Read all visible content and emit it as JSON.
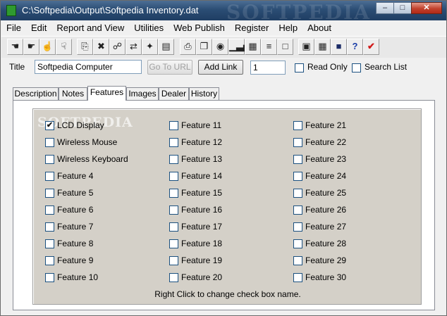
{
  "window": {
    "title": "C:\\Softpedia\\Output\\Softpedia Inventory.dat",
    "watermark": "SOFTPEDIA",
    "minimize_glyph": "–",
    "maximize_glyph": "□",
    "close_glyph": "✕"
  },
  "menu": [
    "File",
    "Edit",
    "Report and View",
    "Utilities",
    "Web Publish",
    "Register",
    "Help",
    "About"
  ],
  "toolbar": {
    "icons": [
      {
        "name": "hand-left-icon",
        "glyph": "☚"
      },
      {
        "name": "hand-right-icon",
        "glyph": "☛"
      },
      {
        "name": "hand-up-icon",
        "glyph": "☝"
      },
      {
        "name": "hand-down-icon",
        "glyph": "☟"
      },
      {
        "name": "copy-doc-icon",
        "glyph": "⎘"
      },
      {
        "name": "delete-doc-icon",
        "glyph": "✖"
      },
      {
        "name": "link-icon",
        "glyph": "☍"
      },
      {
        "name": "transfer-icon",
        "glyph": "⇄"
      },
      {
        "name": "network-icon",
        "glyph": "✦"
      },
      {
        "name": "database-icon",
        "glyph": "▤"
      },
      {
        "name": "print-icon",
        "glyph": "⎙"
      },
      {
        "name": "open-folder-icon",
        "glyph": "❐"
      },
      {
        "name": "camera-icon",
        "glyph": "◉"
      },
      {
        "name": "bar-chart-icon",
        "glyph": "▁▃▅"
      },
      {
        "name": "table-icon",
        "glyph": "▦"
      },
      {
        "name": "report-icon",
        "glyph": "≡"
      },
      {
        "name": "document-icon",
        "glyph": "□"
      },
      {
        "name": "calculator-icon",
        "glyph": "▣"
      },
      {
        "name": "calendar-icon",
        "glyph": "▦"
      },
      {
        "name": "save-disk-icon",
        "glyph": "■"
      },
      {
        "name": "help-icon",
        "glyph": "?"
      },
      {
        "name": "checkmark-icon",
        "glyph": "✔"
      }
    ]
  },
  "titlerow": {
    "title_label": "Title",
    "title_value": "Softpedia Computer",
    "goto_url": "Go To URL",
    "add_link": "Add Link",
    "number_value": "1",
    "read_only": "Read Only",
    "search_list": "Search List"
  },
  "tabs": [
    "Description",
    "Notes",
    "Features",
    "Images",
    "Dealer",
    "History"
  ],
  "active_tab": "Features",
  "features": {
    "watermark": "SOFTPEDIA",
    "items": [
      {
        "label": "LCD Display",
        "checked": true
      },
      {
        "label": "Wireless Mouse",
        "checked": false
      },
      {
        "label": "Wireless Keyboard",
        "checked": false
      },
      {
        "label": "Feature 4",
        "checked": false
      },
      {
        "label": "Feature 5",
        "checked": false
      },
      {
        "label": "Feature 6",
        "checked": false
      },
      {
        "label": "Feature 7",
        "checked": false
      },
      {
        "label": "Feature  8",
        "checked": false
      },
      {
        "label": "Feature  9",
        "checked": false
      },
      {
        "label": "Feature 10",
        "checked": false
      },
      {
        "label": "Feature 11",
        "checked": false
      },
      {
        "label": "Feature 12",
        "checked": false
      },
      {
        "label": "Feature 13",
        "checked": false
      },
      {
        "label": "Feature 14",
        "checked": false
      },
      {
        "label": "Feature 15",
        "checked": false
      },
      {
        "label": "Feature 16",
        "checked": false
      },
      {
        "label": "Feature 17",
        "checked": false
      },
      {
        "label": "Feature 18",
        "checked": false
      },
      {
        "label": "Feature 19",
        "checked": false
      },
      {
        "label": "Feature 20",
        "checked": false
      },
      {
        "label": "Feature 21",
        "checked": false
      },
      {
        "label": "Feature 22",
        "checked": false
      },
      {
        "label": "Feature 23",
        "checked": false
      },
      {
        "label": "Feature 24",
        "checked": false
      },
      {
        "label": "Feature 25",
        "checked": false
      },
      {
        "label": "Feature 26",
        "checked": false
      },
      {
        "label": "Feature 27",
        "checked": false
      },
      {
        "label": "Feature 28",
        "checked": false
      },
      {
        "label": "Feature 29",
        "checked": false
      },
      {
        "label": "Feature 30",
        "checked": false
      }
    ],
    "hint": "Right Click to change check box name."
  }
}
